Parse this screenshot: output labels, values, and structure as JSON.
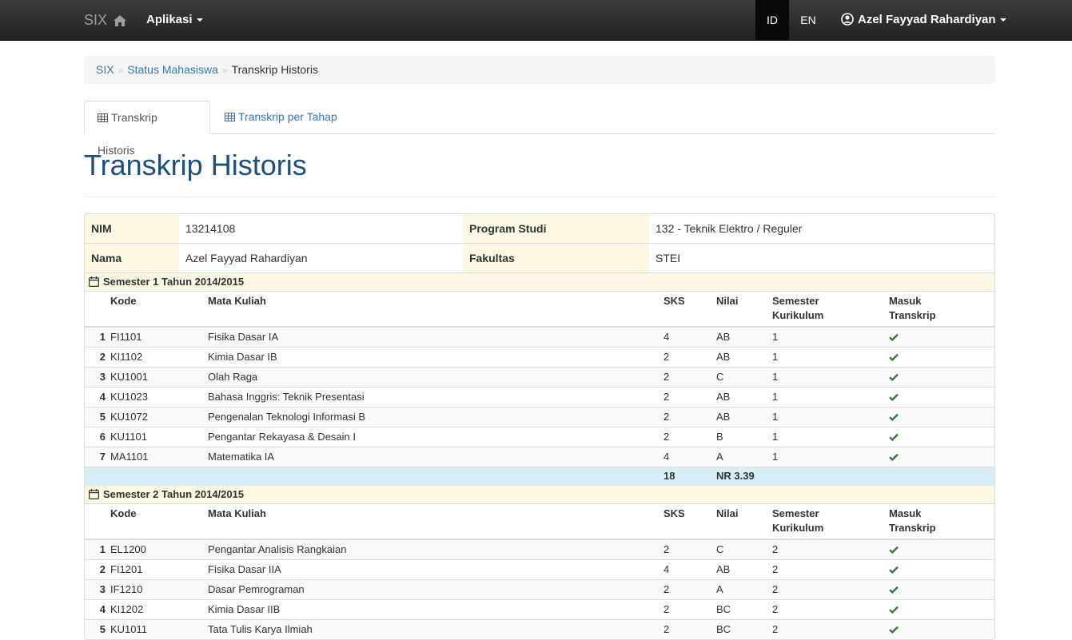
{
  "navbar": {
    "brand": "SIX",
    "apps_label": "Aplikasi",
    "lang_id": "ID",
    "lang_en": "EN",
    "user_name": "Azel Fayyad Rahardiyan"
  },
  "breadcrumb": {
    "items": [
      "SIX",
      "Status Mahasiswa"
    ],
    "active": "Transkrip Historis"
  },
  "tabs": [
    "Transkrip Historis",
    "Transkrip per Tahap"
  ],
  "page_title": "Transkrip Historis",
  "info": {
    "nim_label": "NIM",
    "nim": "13214108",
    "prodi_label": "Program Studi",
    "prodi": "132 - Teknik Elektro / Reguler",
    "nama_label": "Nama",
    "nama": "Azel Fayyad Rahardiyan",
    "fakultas_label": "Fakultas",
    "fakultas": "STEI"
  },
  "columns": {
    "kode": "Kode",
    "mata_kuliah": "Mata Kuliah",
    "sks": "SKS",
    "nilai": "Nilai",
    "semester_1": "Semester",
    "semester_2": "Kurikulum",
    "masuk_1": "Masuk",
    "masuk_2": "Transkrip"
  },
  "semesters": [
    {
      "title": "Semester 1 Tahun 2014/2015",
      "courses": [
        {
          "no": "1",
          "kode": "FI1101",
          "nama": "Fisika Dasar IA",
          "sks": "4",
          "nilai": "AB",
          "sem": "1"
        },
        {
          "no": "2",
          "kode": "KI1102",
          "nama": "Kimia Dasar IB",
          "sks": "2",
          "nilai": "AB",
          "sem": "1"
        },
        {
          "no": "3",
          "kode": "KU1001",
          "nama": "Olah Raga",
          "sks": "2",
          "nilai": "C",
          "sem": "1"
        },
        {
          "no": "4",
          "kode": "KU1023",
          "nama": "Bahasa Inggris: Teknik Presentasi",
          "sks": "2",
          "nilai": "AB",
          "sem": "1"
        },
        {
          "no": "5",
          "kode": "KU1072",
          "nama": "Pengenalan Teknologi Informasi B",
          "sks": "2",
          "nilai": "AB",
          "sem": "1"
        },
        {
          "no": "6",
          "kode": "KU1101",
          "nama": "Pengantar Rekayasa & Desain I",
          "sks": "2",
          "nilai": "B",
          "sem": "1"
        },
        {
          "no": "7",
          "kode": "MA1101",
          "nama": "Matematika IA",
          "sks": "4",
          "nilai": "A",
          "sem": "1"
        }
      ],
      "total_sks": "18",
      "nr": "NR 3.39"
    },
    {
      "title": "Semester 2 Tahun 2014/2015",
      "courses": [
        {
          "no": "1",
          "kode": "EL1200",
          "nama": "Pengantar Analisis Rangkaian",
          "sks": "2",
          "nilai": "C",
          "sem": "2"
        },
        {
          "no": "2",
          "kode": "FI1201",
          "nama": "Fisika Dasar IIA",
          "sks": "4",
          "nilai": "AB",
          "sem": "2"
        },
        {
          "no": "3",
          "kode": "IF1210",
          "nama": "Dasar Pemrograman",
          "sks": "2",
          "nilai": "A",
          "sem": "2"
        },
        {
          "no": "4",
          "kode": "KI1202",
          "nama": "Kimia Dasar IIB",
          "sks": "2",
          "nilai": "BC",
          "sem": "2"
        },
        {
          "no": "5",
          "kode": "KU1011",
          "nama": "Tata Tulis Karya Ilmiah",
          "sks": "2",
          "nilai": "BC",
          "sem": "2"
        }
      ]
    }
  ],
  "colors": {
    "check": "#3c763d",
    "link": "#337ab7",
    "warning_bg": "#fcf8e3",
    "info_bg": "#d9edf7"
  },
  "icons": [
    "home-icon",
    "user-circle-icon",
    "grid-icon",
    "calendar-icon",
    "check-icon"
  ]
}
